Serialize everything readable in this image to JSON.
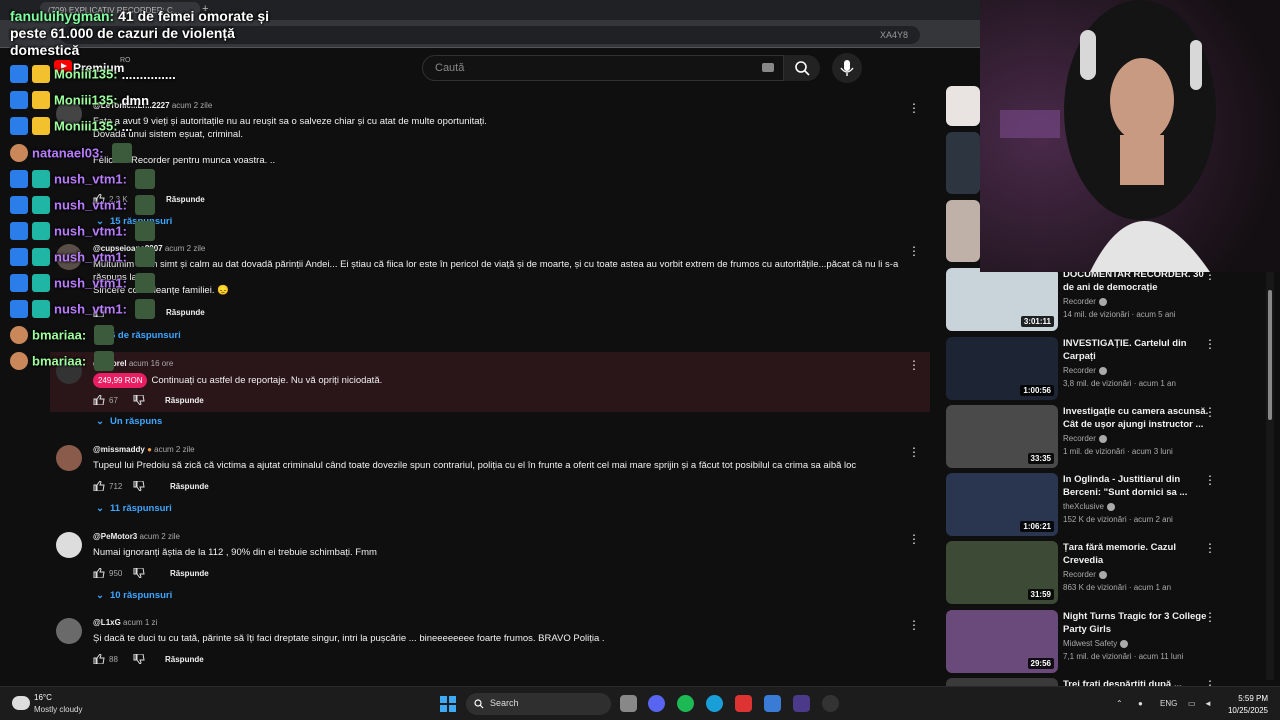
{
  "browser": {
    "tab_title": "(709) EXPLICATIV RECORDER: C...",
    "url_fragment": "XA4Y8"
  },
  "header": {
    "logo_label": "Premium",
    "region": "RO",
    "search_placeholder": "Caută"
  },
  "comments": [
    {
      "author": "@LeTonic...Lr...2227",
      "time": "acum 2 zile",
      "lines": [
        "Fata a avut 9 vieți și autoritațile nu au reușit sa o salveze chiar și cu atat de multe oportunitați.",
        "Dovada unui sistem eșuat, criminal.",
        "",
        "Felicitări Recorder pentru munca voastra. .."
      ],
      "likes": "2,3 K",
      "reply": "Răspunde",
      "replies": "15 răspunsuri"
    },
    {
      "author": "@cupseioana8007",
      "time": "acum 2 zile",
      "lines": [
        "Multumim că m simt și calm au dat dovadă părinții Andei... Ei știau că fiica lor este în pericol de viață și de moarte, și cu toate astea au vorbit extrem de frumos cu autoritățile...păcat că nu li s-a răspuns la fel.",
        "Sincere condoleanțe familiei. 😞"
      ],
      "likes": "",
      "reply": "Răspunde",
      "replies": "6 de răspunsuri"
    },
    {
      "author": "@...sorel",
      "time": "acum 16 ore",
      "superchat": "249,99 RON",
      "lines": [
        "Continuați cu astfel de reportaje. Nu vă opriți niciodată."
      ],
      "likes": "67",
      "reply": "Răspunde",
      "replies": "Un răspuns"
    },
    {
      "author": "@missmaddy",
      "time": "acum 2 zile",
      "lines": [
        "Tupeul lui Predoiu să zică că victima a ajutat criminalul când toate dovezile spun contrariul, poliția cu el în frunte a oferit cel mai mare sprijin și a făcut tot posibilul ca crima sa aibă loc"
      ],
      "likes": "712",
      "reply": "Răspunde",
      "replies": "11 răspunsuri"
    },
    {
      "author": "@PeMotor3",
      "time": "acum 2 zile",
      "lines": [
        "Numai ignoranți ăștia de la 112 , 90% din ei trebuie schimbați. Fmm"
      ],
      "likes": "950",
      "reply": "Răspunde",
      "replies": "10 răspunsuri"
    },
    {
      "author": "@L1xG",
      "time": "acum 1 zi",
      "lines": [
        "Și dacă te duci tu cu tată, părinte să îți faci dreptate singur, intri la pușcărie ... bineeeeeeee foarte frumos. BRAVO Poliția ."
      ],
      "likes": "88",
      "reply": "Răspunde",
      "replies": ""
    }
  ],
  "sidebar": [
    {
      "title": "DOCUMENTAR RECORDER. 30 de ani de democrație",
      "channel": "Recorder",
      "meta": "14 mil. de vizionări · acum 5 ani",
      "duration": "3:01:11",
      "color": "#c9d3da"
    },
    {
      "title": "INVESTIGAȚIE. Cartelul din Carpați",
      "channel": "Recorder",
      "meta": "3,8 mil. de vizionări · acum 1 an",
      "duration": "1:00:56",
      "color": "#1d2433"
    },
    {
      "title": "Investigație cu camera ascunsă. Cât de ușor ajungi instructor ...",
      "channel": "Recorder",
      "meta": "1 mil. de vizionări · acum 3 luni",
      "duration": "33:35",
      "color": "#4a4a4a"
    },
    {
      "title": "In Oglinda - Justitiarul din Berceni: \"Sunt dornici sa ...",
      "channel": "theXclusive",
      "meta": "152 K de vizionări · acum 2 ani",
      "duration": "1:06:21",
      "color": "#2a3550"
    },
    {
      "title": "Țara fără memorie. Cazul Crevedia",
      "channel": "Recorder",
      "meta": "863 K de vizionări · acum 1 an",
      "duration": "31:59",
      "color": "#3d4a36"
    },
    {
      "title": "Night Turns Tragic for 3 College Party Girls",
      "channel": "Midwest Safety",
      "meta": "7,1 mil. de vizionări · acum 11 luni",
      "duration": "29:56",
      "color": "#6a4a7a"
    },
    {
      "title": "Trei frați despărțiți după ...",
      "channel": "",
      "meta": "",
      "duration": "",
      "color": "#3a3a3a"
    }
  ],
  "overlay": {
    "alert_name": "fanuluihygman:",
    "alert_text": "41 de femei omorate și peste 61.000 de cazuri de violență domestică",
    "chat": [
      {
        "name": "Moniii135:",
        "msg": "...............",
        "color": "#9dff9d",
        "badges": [
          "blue",
          "gold"
        ],
        "emote": false
      },
      {
        "name": "Moniii135:",
        "msg": "dmn",
        "color": "#9dff9d",
        "badges": [
          "blue",
          "gold"
        ],
        "emote": false
      },
      {
        "name": "Moniii135:",
        "msg": "...",
        "color": "#9dff9d",
        "badges": [
          "blue",
          "gold"
        ],
        "emote": false
      },
      {
        "name": "natanael03:",
        "msg": "",
        "color": "#b97cff",
        "badges": [
          "emoji"
        ],
        "emote": true
      },
      {
        "name": "nush_vtm1:",
        "msg": "",
        "color": "#b97cff",
        "badges": [
          "blue",
          "sub"
        ],
        "emote": true
      },
      {
        "name": "nush_vtm1:",
        "msg": "",
        "color": "#b97cff",
        "badges": [
          "blue",
          "sub"
        ],
        "emote": true
      },
      {
        "name": "nush_vtm1:",
        "msg": "",
        "color": "#b97cff",
        "badges": [
          "blue",
          "sub"
        ],
        "emote": true
      },
      {
        "name": "nush_vtm1:",
        "msg": "",
        "color": "#b97cff",
        "badges": [
          "blue",
          "sub"
        ],
        "emote": true
      },
      {
        "name": "nush_vtm1:",
        "msg": "",
        "color": "#b97cff",
        "badges": [
          "blue",
          "sub"
        ],
        "emote": true
      },
      {
        "name": "nush_vtm1:",
        "msg": "",
        "color": "#b97cff",
        "badges": [
          "blue",
          "sub"
        ],
        "emote": true
      },
      {
        "name": "bmariaa:",
        "msg": "",
        "color": "#9dff9d",
        "badges": [
          "emoji"
        ],
        "emote": true
      },
      {
        "name": "bmariaa:",
        "msg": "",
        "color": "#9dff9d",
        "badges": [
          "emoji"
        ],
        "emote": true
      }
    ]
  },
  "taskbar": {
    "temp": "16°C",
    "weather": "Mostly cloudy",
    "search": "Search",
    "lang": "ENG",
    "time": "5:59 PM",
    "date": "10/25/2025"
  }
}
